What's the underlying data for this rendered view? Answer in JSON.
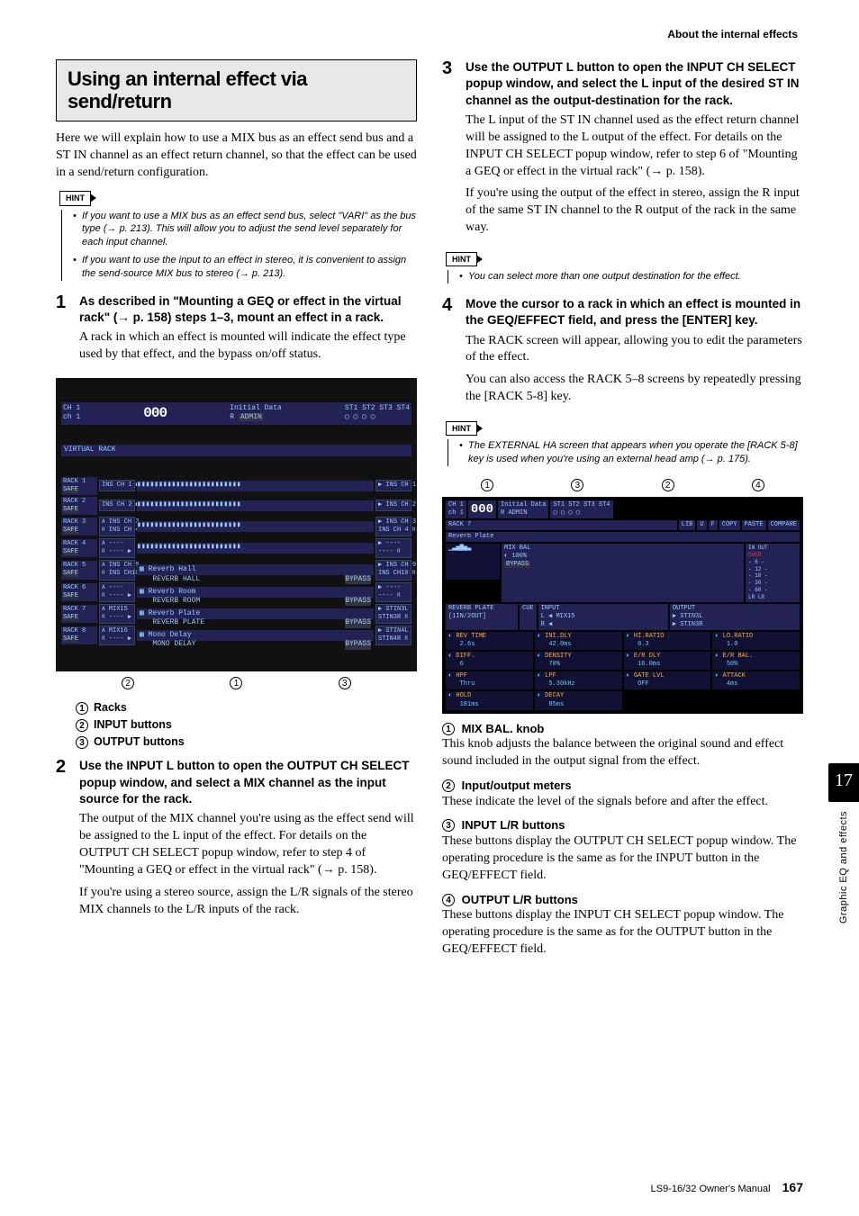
{
  "header": {
    "section": "About the internal effects"
  },
  "title": "Using an internal effect via send/return",
  "intro": "Here we will explain how to use a MIX bus as an effect send bus and a ST IN channel as an effect return channel, so that the effect can be used in a send/return configuration.",
  "hint_label": "HINT",
  "hints_top": [
    "If you want to use a MIX bus as an effect send bus, select \"VARI\" as the bus type (→ p. 213). This will allow you to adjust the send level separately for each input channel.",
    "If you want to use the input to an effect in stereo, it is convenient to assign the send-source MIX bus to stereo (→ p. 213)."
  ],
  "step1": {
    "num": "1",
    "head": "As described in \"Mounting a GEQ or effect in the virtual rack\" (→ p. 158) steps 1–3, mount an effect in a rack.",
    "body": "A rack in which an effect is mounted will indicate the effect type used by that effect, and the bypass on/off status."
  },
  "figure1": {
    "ch": "CH 1",
    "chlabel": "ch 1",
    "scene": "000",
    "libname": "Initial Data",
    "r": "R",
    "admin": "ADMIN",
    "st": [
      "ST1",
      "ST2",
      "ST3",
      "ST4"
    ],
    "title": "VIRTUAL RACK",
    "rows": [
      {
        "rack": "RACK 1",
        "safe": "SAFE",
        "inL": "INS CH 1",
        "out": "INS CH 1"
      },
      {
        "rack": "RACK 2",
        "safe": "SAFE",
        "inL": "INS CH 2",
        "out": "INS CH 2"
      },
      {
        "rack": "RACK 3",
        "safe": "SAFE",
        "inL": "INS CH 3",
        "inR": "INS CH 4",
        "out": "INS CH 3",
        "outR": "INS CH 4"
      },
      {
        "rack": "RACK 4",
        "safe": "SAFE",
        "inL": "----",
        "inR": "----",
        "out": "----",
        "outR": "----"
      },
      {
        "rack": "RACK 5",
        "safe": "SAFE",
        "inL": "INS CH 9",
        "inR": "INS CH10",
        "fx": "Reverb Hall",
        "fxsub": "REVERB HALL",
        "byp": "BYPASS",
        "out": "INS CH 9",
        "outR": "INS CH10"
      },
      {
        "rack": "RACK 6",
        "safe": "SAFE",
        "inL": "----",
        "inR": "----",
        "fx": "Reverb Room",
        "fxsub": "REVERB ROOM",
        "byp": "BYPASS",
        "out": "----",
        "outR": "----"
      },
      {
        "rack": "RACK 7",
        "safe": "SAFE",
        "inL": "MIX15",
        "inR": "----",
        "fx": "Reverb Plate",
        "fxsub": "REVERB PLATE",
        "byp": "BYPASS",
        "out": "STIN3L",
        "outR": "STIN3R"
      },
      {
        "rack": "RACK 8",
        "safe": "SAFE",
        "inL": "MIX16",
        "inR": "----",
        "fx": "Mono Delay",
        "fxsub": "MONO DELAY",
        "byp": "BYPASS",
        "out": "STIN4L",
        "outR": "STIN4R"
      }
    ],
    "callouts": [
      "2",
      "1",
      "3"
    ]
  },
  "legend1": [
    {
      "n": "1",
      "label": "Racks"
    },
    {
      "n": "2",
      "label": "INPUT buttons"
    },
    {
      "n": "3",
      "label": "OUTPUT buttons"
    }
  ],
  "step2": {
    "num": "2",
    "head": "Use the INPUT L button to open the OUTPUT CH SELECT popup window, and select a MIX channel as the input source for the rack.",
    "body1": "The output of the MIX channel you're using as the effect send will be assigned to the L input of the effect. For details on the OUTPUT CH SELECT popup window, refer to step 4 of \"Mounting a GEQ or effect in the virtual rack\" (→ p. 158).",
    "body2": "If you're using a stereo source, assign the L/R signals of the stereo MIX channels to the L/R inputs of the rack."
  },
  "step3": {
    "num": "3",
    "head": "Use the OUTPUT L button to open the INPUT CH SELECT popup window, and select the L input of the desired ST IN channel as the output-destination for the rack.",
    "body1": "The L input of the ST IN channel used as the effect return channel will be assigned to the L output of the effect. For details on the INPUT CH SELECT popup window, refer to step 6 of \"Mounting a GEQ or effect in the virtual rack\" (→ p. 158).",
    "body2": "If you're using the output of the effect in stereo, assign the R input of the same ST IN channel to the R output of the rack in the same way."
  },
  "hints_step3": [
    "You can select more than one output destination for the effect."
  ],
  "step4": {
    "num": "4",
    "head": "Move the cursor to a rack in which an effect is mounted in the GEQ/EFFECT field, and press the [ENTER] key.",
    "body1": "The RACK screen will appear, allowing you to edit the parameters of the effect.",
    "body2": "You can also access the RACK 5–8 screens by repeatedly pressing the [RACK 5-8] key."
  },
  "hints_step4": [
    "The EXTERNAL HA screen that appears when you operate the [RACK 5-8] key is used when you're using an external head amp (→ p. 175)."
  ],
  "figure2": {
    "top_callouts": [
      "1",
      "3",
      "2",
      "4"
    ],
    "ch": "CH 1",
    "chlabel": "ch 1",
    "scene": "000",
    "lib": "Initial Data",
    "r": "R",
    "admin": "ADMIN",
    "st": [
      "ST1",
      "ST2",
      "ST3",
      "ST4"
    ],
    "rack": "RACK 7",
    "btns": [
      "LIB",
      "U",
      "F",
      "COPY",
      "PASTE",
      "COMPARE"
    ],
    "plate": "Reverb Plate",
    "mixbal": "MIX BAL",
    "mixval": "100%",
    "bypass": "BYPASS",
    "meters": {
      "in": "IN",
      "out": "OUT",
      "over": "OVER",
      "scale": [
        "0",
        "- 6 -",
        "- 12 -",
        "- 18 -",
        "- 30 -",
        "- 60 -"
      ],
      "lr": "LR"
    },
    "io": {
      "title": "REVERB PLATE",
      "sub": "[1IN/2OUT]",
      "cue": "CUE",
      "input": "INPUT",
      "output": "OUTPUT",
      "inL": "MIX15",
      "inR": "",
      "outL": "STIN3L",
      "outR": "STIN3R",
      "L": "L",
      "R": "R"
    },
    "params": [
      {
        "name": "REV TIME",
        "val": "2.6s"
      },
      {
        "name": "INI.DLY",
        "val": "42.0ms"
      },
      {
        "name": "HI.RATIO",
        "val": "0.3"
      },
      {
        "name": "LO.RATIO",
        "val": "1.0"
      },
      {
        "name": "DIFF.",
        "val": "6"
      },
      {
        "name": "DENSITY",
        "val": "70%"
      },
      {
        "name": "E/R DLY",
        "val": "16.0ms"
      },
      {
        "name": "E/R BAL.",
        "val": "50%"
      },
      {
        "name": "HPF",
        "val": "Thru"
      },
      {
        "name": "LPF",
        "val": "5.30kHz"
      },
      {
        "name": "GATE LVL",
        "val": "OFF"
      },
      {
        "name": "ATTACK",
        "val": "4ms"
      },
      {
        "name": "HOLD",
        "val": "181ms"
      },
      {
        "name": "DECAY",
        "val": "85ms"
      }
    ]
  },
  "items2": [
    {
      "n": "1",
      "head": "MIX BAL. knob",
      "body": "This knob adjusts the balance between the original sound and effect sound included in the output signal from the effect."
    },
    {
      "n": "2",
      "head": "Input/output meters",
      "body": "These indicate the level of the signals before and after the effect."
    },
    {
      "n": "3",
      "head": "INPUT L/R buttons",
      "body": "These buttons display the OUTPUT CH SELECT popup window. The operating procedure is the same as for the INPUT button in the GEQ/EFFECT field."
    },
    {
      "n": "4",
      "head": "OUTPUT L/R buttons",
      "body": "These buttons display the INPUT CH SELECT popup window. The operating procedure is the same as for the OUTPUT button in the GEQ/EFFECT field."
    }
  ],
  "sidebar": {
    "chapter": "17",
    "title": "Graphic EQ and effects"
  },
  "footer": {
    "manual": "LS9-16/32  Owner's Manual",
    "page": "167"
  }
}
